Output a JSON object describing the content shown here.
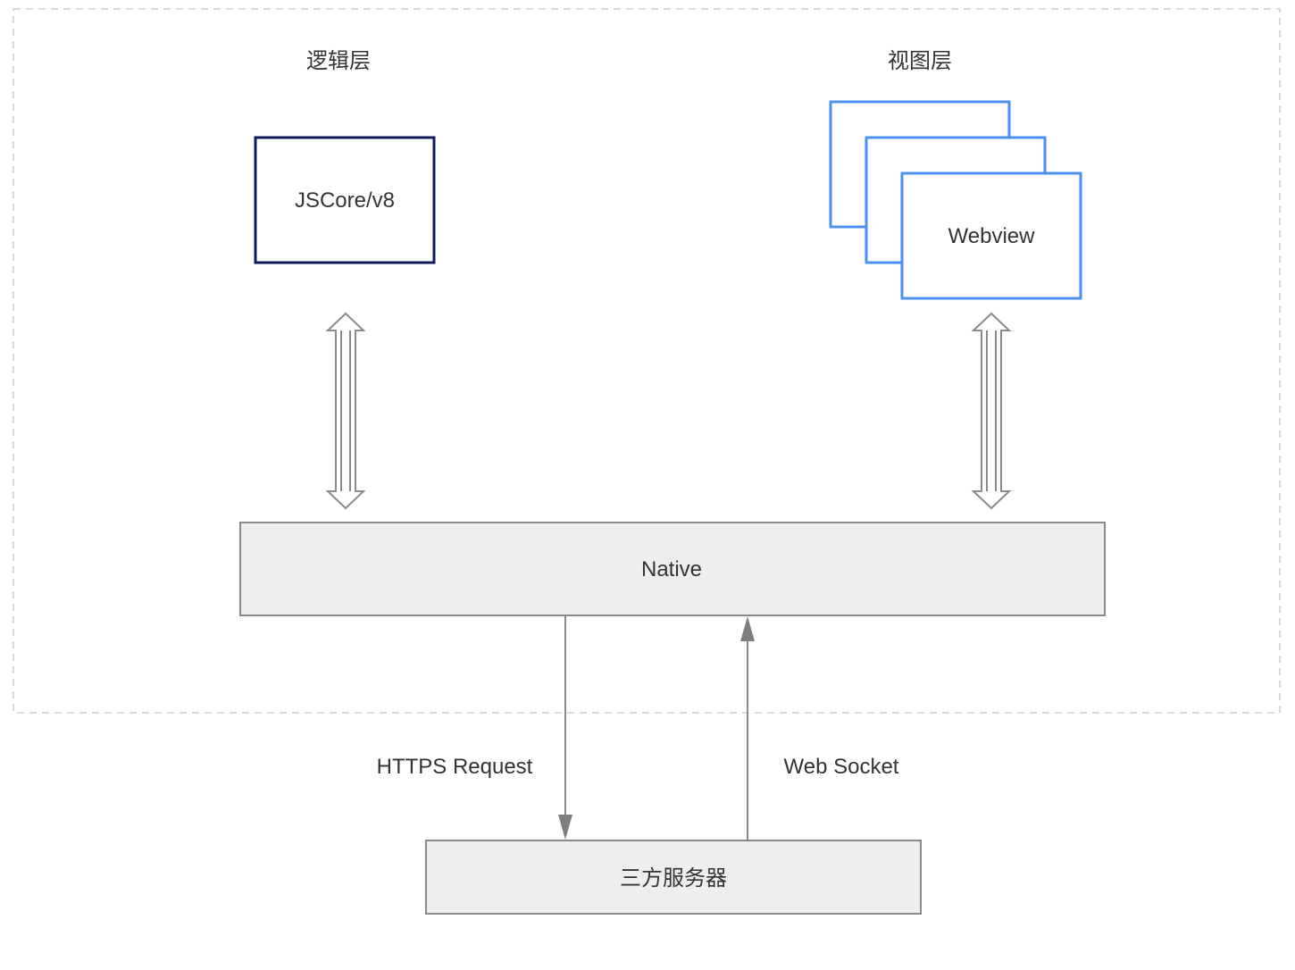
{
  "labels": {
    "logic_layer": "逻辑层",
    "view_layer": "视图层",
    "jscore": "JSCore/v8",
    "webview": "Webview",
    "native": "Native",
    "https_request": "HTTPS Request",
    "web_socket": "Web Socket",
    "third_party_server": "三方服务器"
  },
  "colors": {
    "container_border": "#d9d9d9",
    "jscore_border": "#101a5e",
    "webview_border": "#4b8ff2",
    "box_fill": "#eeeeee",
    "box_border": "#8a8a8a",
    "arrow": "#8a8a8a",
    "text": "#333333"
  }
}
